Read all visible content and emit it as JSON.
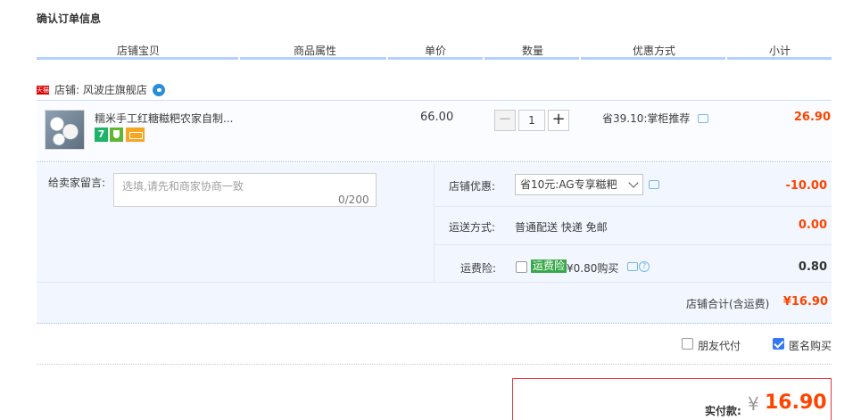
{
  "page_title": "确认订单信息",
  "columns": [
    "店铺宝贝",
    "商品属性",
    "单价",
    "数量",
    "优惠方式",
    "小计"
  ],
  "shop": {
    "label": "店铺: 风波庄旗舰店",
    "tmall_badge": "天猫"
  },
  "item": {
    "title": "糯米手工红糖糍粑农家自制...",
    "badge_seven": "7",
    "price": "66.00",
    "quantity": "1",
    "minus": "−",
    "plus": "+",
    "discount": "省39.10:掌柜推荐",
    "subtotal": "26.90"
  },
  "message": {
    "label": "给卖家留言:",
    "placeholder": "选填,请先和商家协商一致",
    "count": "0/200"
  },
  "shop_discount": {
    "label": "店铺优惠:",
    "selected": "省10元:AG专享糍粑",
    "amount": "-10.00"
  },
  "shipping": {
    "label": "运送方式:",
    "value": "普通配送 快递 免邮",
    "amount": "0.00"
  },
  "insurance": {
    "label": "运费险:",
    "tag": "运费险",
    "price": "¥0.80购买",
    "help": "?",
    "amount": "0.80"
  },
  "shop_total": {
    "label": "店铺合计(含运费)",
    "amount": "¥16.90"
  },
  "options": {
    "friend_pay": "朋友代付",
    "anonymous": "匿名购买",
    "anonymous_checked": true,
    "friend_checked": false
  },
  "payment": {
    "label": "实付款:",
    "yen": "¥",
    "amount": "16.90"
  },
  "colors": {
    "accent": "#ff4400",
    "header_line": "#b2d1ff",
    "panel": "#f2f7ff"
  }
}
